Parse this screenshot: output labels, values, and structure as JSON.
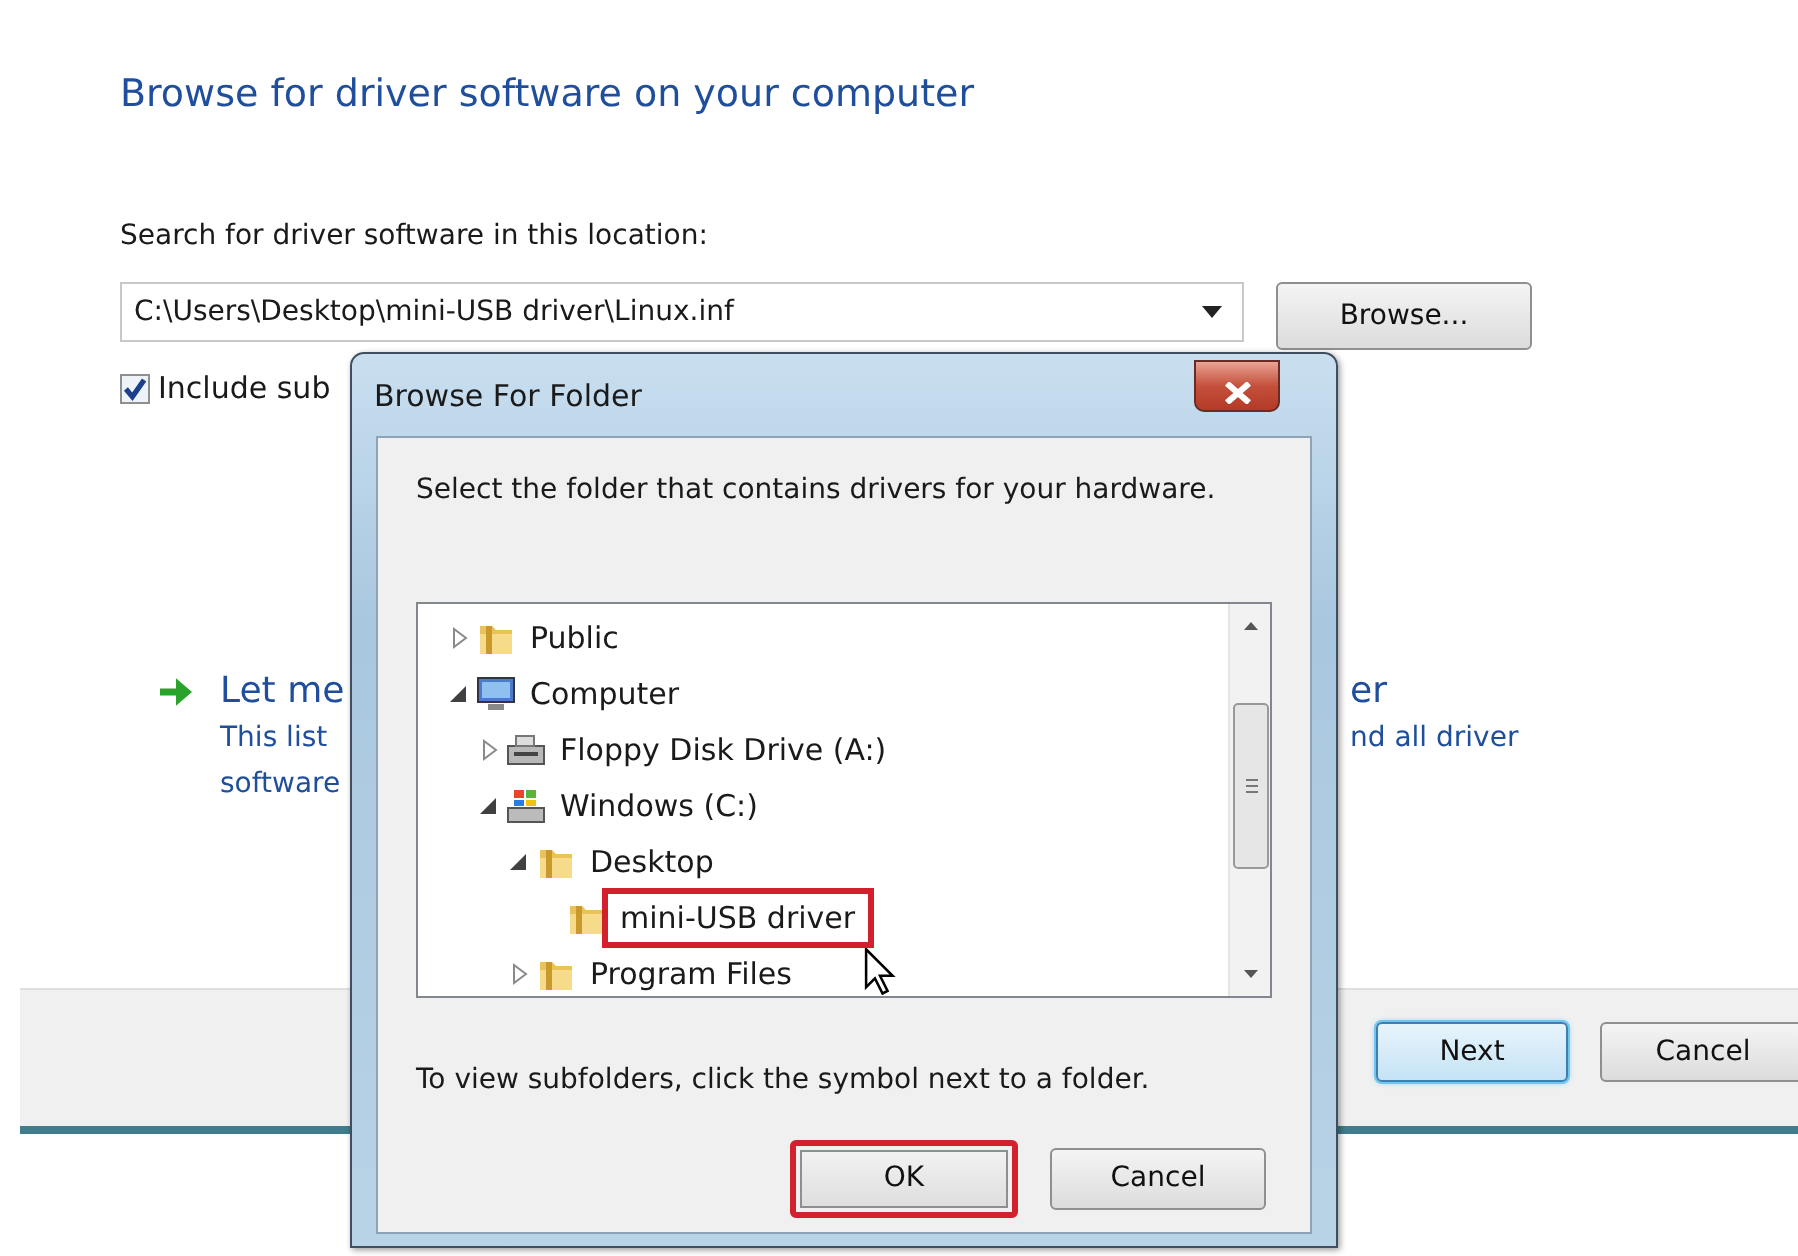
{
  "wizard": {
    "heading": "Browse for driver software on your computer",
    "location_label": "Search for driver software in this location:",
    "location_value": "C:\\Users\\Desktop\\mini-USB driver\\Linux.inf",
    "browse_button": "Browse...",
    "include_checkbox": {
      "label": "Include sub",
      "checked": true
    },
    "option": {
      "left_title": "Let me",
      "left_lines": [
        "This list",
        "software"
      ],
      "right_title": "er",
      "right_lines": [
        "nd all driver"
      ]
    },
    "buttons": [
      {
        "label": "Next",
        "default": true
      },
      {
        "label": "Cancel",
        "default": false
      }
    ]
  },
  "dialog": {
    "title": "Browse For Folder",
    "instruction": "Select the folder that contains drivers for your hardware.",
    "tree": [
      {
        "label": "Public",
        "kind": "folder",
        "expanded": false,
        "highlighted": false
      },
      {
        "label": "Computer",
        "kind": "computer",
        "expanded": true,
        "highlighted": false,
        "children": [
          {
            "label": "Floppy Disk Drive (A:)",
            "kind": "floppy",
            "expanded": false,
            "highlighted": false
          },
          {
            "label": "Windows (C:)",
            "kind": "drive",
            "expanded": true,
            "highlighted": false,
            "children": [
              {
                "label": "Desktop",
                "kind": "folder",
                "expanded": true,
                "highlighted": false,
                "children": [
                  {
                    "label": "mini-USB driver",
                    "kind": "folder",
                    "highlighted": true
                  }
                ]
              },
              {
                "label": "Program Files",
                "kind": "folder",
                "expanded": false,
                "highlighted": false
              }
            ]
          }
        ]
      }
    ],
    "hint": "To view subfolders, click the symbol next to a folder.",
    "buttons": [
      {
        "label": "OK",
        "highlighted": true
      },
      {
        "label": "Cancel",
        "highlighted": false
      }
    ]
  }
}
